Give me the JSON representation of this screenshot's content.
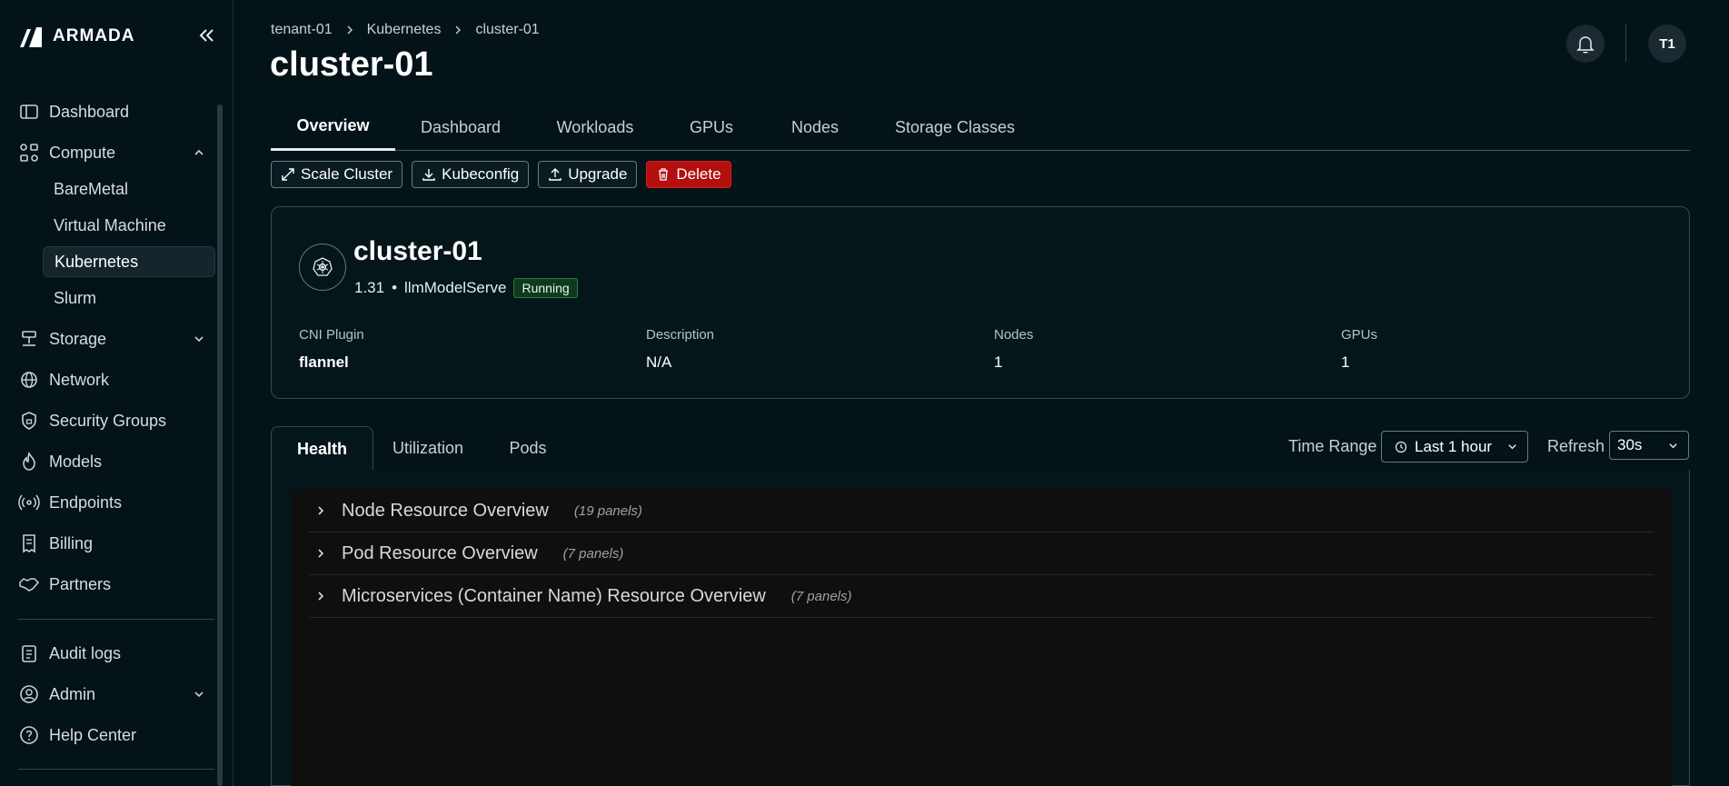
{
  "app": {
    "brand": "ARMADA"
  },
  "sidebar": {
    "items": [
      {
        "label": "Dashboard",
        "icon": "dashboard-icon"
      },
      {
        "label": "Compute",
        "icon": "compute-icon",
        "expanded": true
      },
      {
        "label": "Storage",
        "icon": "storage-icon"
      },
      {
        "label": "Network",
        "icon": "network-icon"
      },
      {
        "label": "Security Groups",
        "icon": "shield-icon"
      },
      {
        "label": "Models",
        "icon": "flame-icon"
      },
      {
        "label": "Endpoints",
        "icon": "broadcast-icon"
      },
      {
        "label": "Billing",
        "icon": "receipt-icon"
      },
      {
        "label": "Partners",
        "icon": "handshake-icon"
      },
      {
        "label": "Audit logs",
        "icon": "clipboard-icon"
      },
      {
        "label": "Admin",
        "icon": "user-gear-icon"
      },
      {
        "label": "Help Center",
        "icon": "help-icon"
      }
    ],
    "compute_sub": [
      "BareMetal",
      "Virtual Machine",
      "Kubernetes",
      "Slurm"
    ],
    "active_sub": "Kubernetes"
  },
  "header": {
    "breadcrumb": [
      "tenant-01",
      "Kubernetes",
      "cluster-01"
    ],
    "title": "cluster-01",
    "avatar": "T1"
  },
  "tabs": [
    "Overview",
    "Dashboard",
    "Workloads",
    "GPUs",
    "Nodes",
    "Storage Classes"
  ],
  "active_tab": "Overview",
  "actions": {
    "scale": "Scale Cluster",
    "kubeconfig": "Kubeconfig",
    "upgrade": "Upgrade",
    "delete": "Delete"
  },
  "cluster": {
    "name": "cluster-01",
    "version": "1.31",
    "bullet": "•",
    "workload": "llmModelServe",
    "status": "Running",
    "fields": [
      {
        "label": "CNI Plugin",
        "value": "flannel"
      },
      {
        "label": "Description",
        "value": "N/A"
      },
      {
        "label": "Nodes",
        "value": "1"
      },
      {
        "label": "GPUs",
        "value": "1"
      }
    ]
  },
  "subtabs": [
    "Health",
    "Utilization",
    "Pods"
  ],
  "active_subtab": "Health",
  "controls": {
    "time_range_label": "Time Range",
    "time_range_value": "Last 1 hour",
    "refresh_label": "Refresh",
    "refresh_value": "30s"
  },
  "rows": [
    {
      "title": "Node Resource Overview",
      "count": "(19 panels)"
    },
    {
      "title": "Pod Resource Overview",
      "count": "(7 panels)"
    },
    {
      "title": "Microservices (Container Name) Resource Overview",
      "count": "(7 panels)"
    }
  ],
  "colors": {
    "background": "#041318",
    "danger": "#b30f0f",
    "running_badge": "#0f3a22"
  }
}
